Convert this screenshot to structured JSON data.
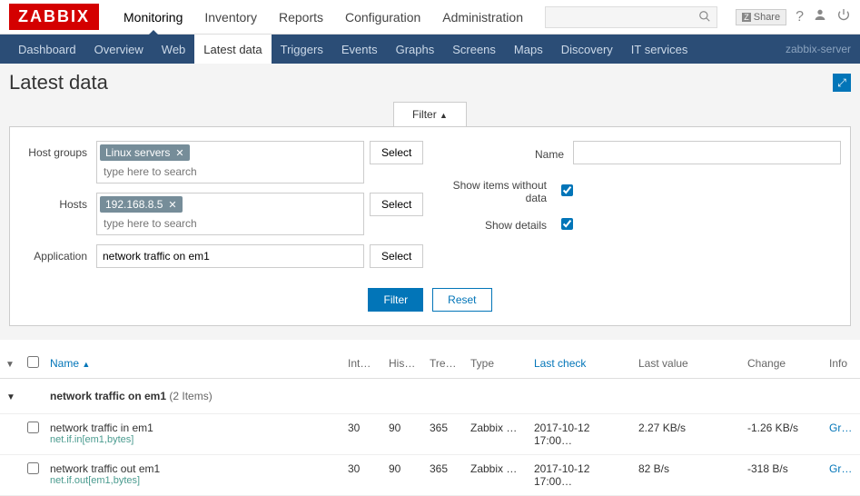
{
  "logo": "ZABBIX",
  "topnav": {
    "items": [
      "Monitoring",
      "Inventory",
      "Reports",
      "Configuration",
      "Administration"
    ],
    "active": 0,
    "share": "Share"
  },
  "subnav": {
    "items": [
      "Dashboard",
      "Overview",
      "Web",
      "Latest data",
      "Triggers",
      "Events",
      "Graphs",
      "Screens",
      "Maps",
      "Discovery",
      "IT services"
    ],
    "active": 3,
    "right": "zabbix-server"
  },
  "page_title": "Latest data",
  "filter": {
    "tab_label": "Filter",
    "host_groups_label": "Host groups",
    "host_groups_tag": "Linux servers",
    "hosts_label": "Hosts",
    "hosts_tag": "192.168.8.5",
    "placeholder": "type here to search",
    "application_label": "Application",
    "application_value": "network traffic on em1",
    "name_label": "Name",
    "name_value": "",
    "show_no_data_label": "Show items without data",
    "show_no_data": true,
    "show_details_label": "Show details",
    "show_details": true,
    "select_btn": "Select",
    "filter_btn": "Filter",
    "reset_btn": "Reset"
  },
  "table": {
    "headers": {
      "name": "Name",
      "interval": "Int…",
      "history": "His…",
      "trends": "Tre…",
      "type": "Type",
      "last_check": "Last check",
      "last_value": "Last value",
      "change": "Change",
      "info": "Info"
    },
    "group": {
      "name": "network traffic on em1",
      "count": "(2 Items)"
    },
    "rows": [
      {
        "name": "network traffic in em1",
        "key": "net.if.in[em1,bytes]",
        "interval": "30",
        "history": "90",
        "trends": "365",
        "type": "Zabbix …",
        "last_check": "2017-10-12 17:00…",
        "last_value": "2.27 KB/s",
        "change": "-1.26 KB/s",
        "info": "Gr…"
      },
      {
        "name": "network traffic out em1",
        "key": "net.if.out[em1,bytes]",
        "interval": "30",
        "history": "90",
        "trends": "365",
        "type": "Zabbix …",
        "last_check": "2017-10-12 17:00…",
        "last_value": "82 B/s",
        "change": "-318 B/s",
        "info": "Gr…"
      }
    ]
  }
}
